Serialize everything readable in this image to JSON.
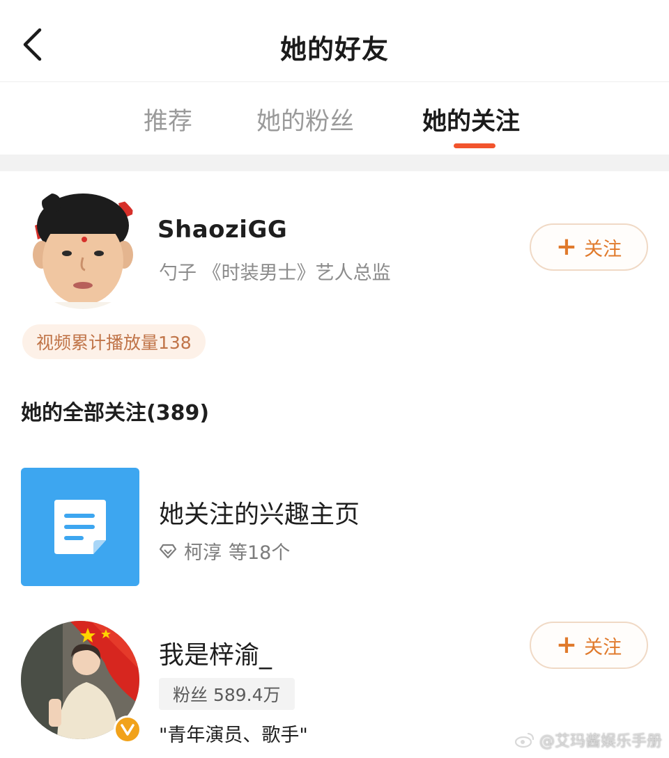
{
  "header": {
    "title": "她的好友"
  },
  "tabs": [
    {
      "label": "推荐",
      "active": false
    },
    {
      "label": "她的粉丝",
      "active": false
    },
    {
      "label": "她的关注",
      "active": true
    }
  ],
  "featured_user": {
    "name": "ShaoziGG",
    "description": "勺子 《时装男士》艺人总监",
    "follow_label": "关注",
    "stat_badge": "视频累计播放量138"
  },
  "section": {
    "title": "她的全部关注(389)"
  },
  "interest_page": {
    "title": "她关注的兴趣主页",
    "subtitle_name": "柯淳",
    "subtitle_count": "等18个",
    "icon": "document-icon"
  },
  "user2": {
    "name": "我是梓渝_",
    "fans": "粉丝 589.4万",
    "bio": "\"青年演员、歌手\"",
    "follow_label": "关注",
    "verified": true
  },
  "watermark": "@艾玛酱娱乐手册",
  "colors": {
    "accent": "#f2542d",
    "follow_text": "#e07a2c",
    "tile_blue": "#3da6f0",
    "badge_bg": "#fdf1e8",
    "verified": "#f1a21a"
  }
}
